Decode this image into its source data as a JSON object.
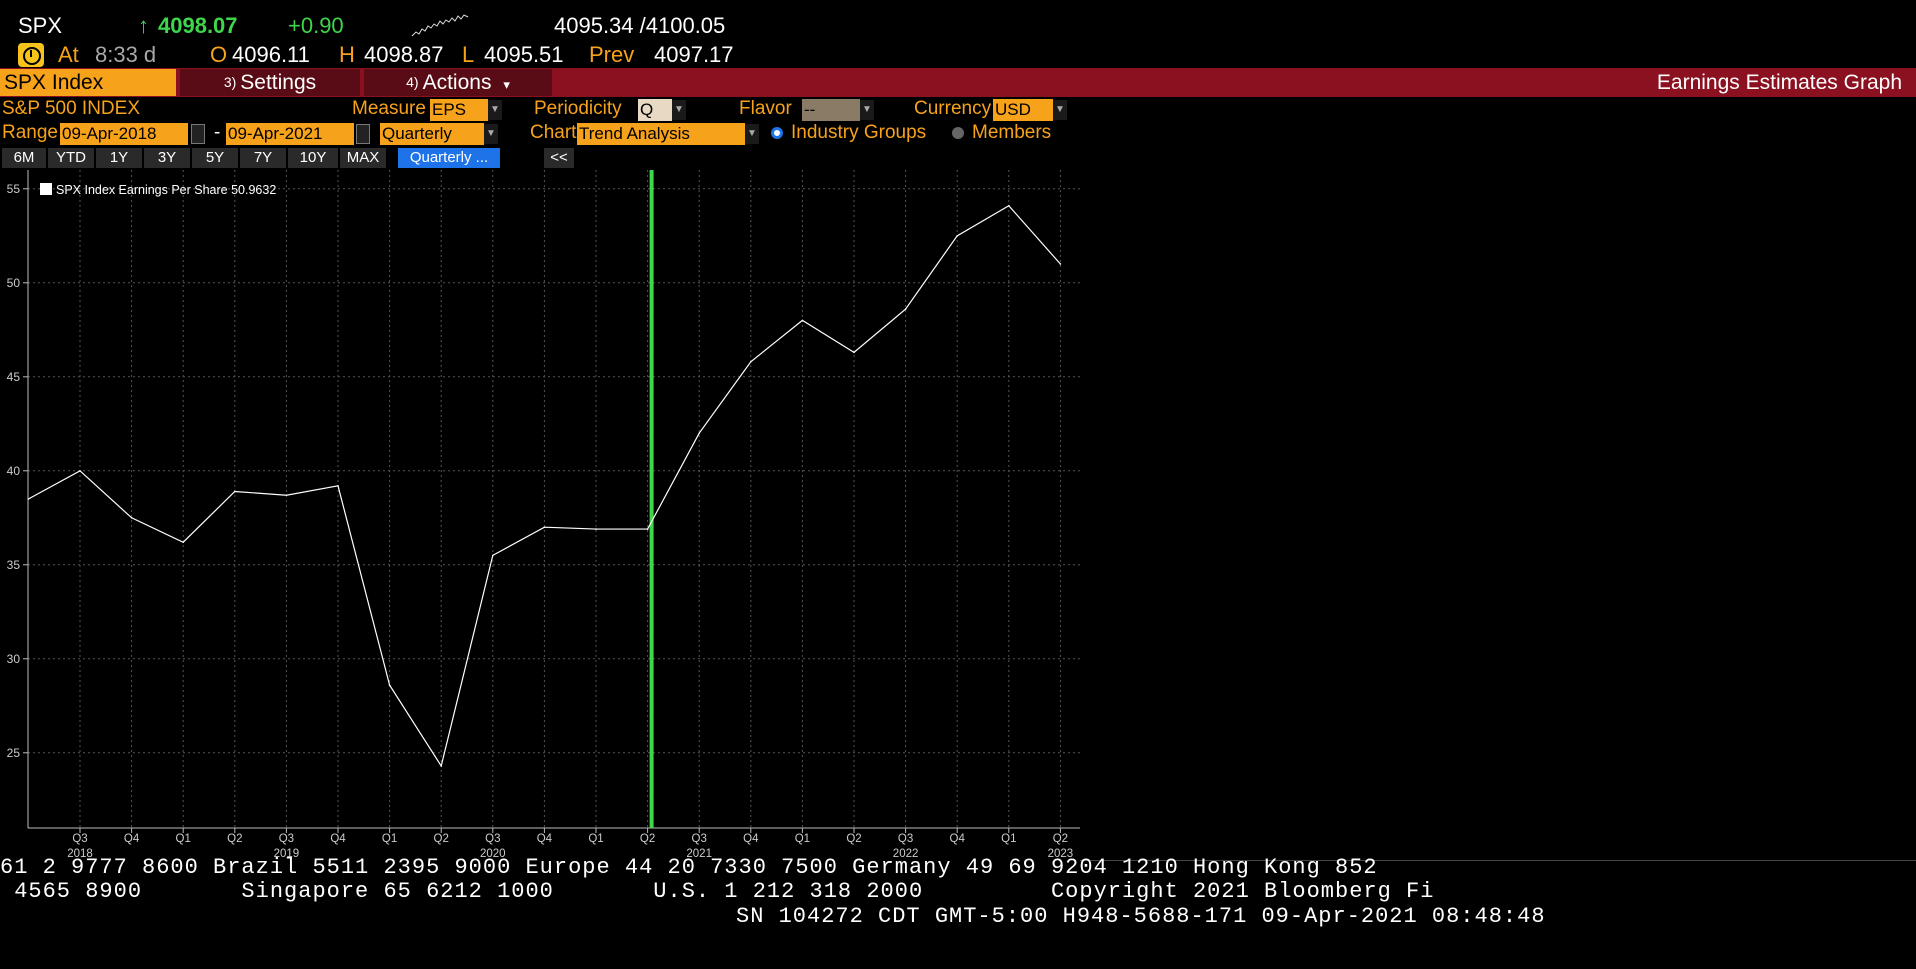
{
  "quote": {
    "ticker": "SPX",
    "arrow": "↑",
    "last": "4098.07",
    "change": "+0.90",
    "bid_ask": "4095.34 /4100.05",
    "at_label": "At",
    "time": "8:33 d",
    "open_label": "O",
    "open": "4096.11",
    "high_label": "H",
    "high": "4098.87",
    "low_label": "L",
    "low": "4095.51",
    "prev_label": "Prev",
    "prev": "4097.17"
  },
  "tabs": {
    "security": "SPX Index",
    "settings_num": "3)",
    "settings": "Settings",
    "actions_num": "4)",
    "actions": "Actions",
    "actions_caret": "▾",
    "screen_title": "Earnings Estimates Graph"
  },
  "controls": {
    "index_name": "S&P 500 INDEX",
    "measure_label": "Measure",
    "measure_value": "EPS",
    "periodicity_label": "Periodicity",
    "periodicity_value": "Q",
    "flavor_label": "Flavor",
    "flavor_value": "--",
    "currency_label": "Currency",
    "currency_value": "USD",
    "range_label": "Range",
    "range_start": "09-Apr-2018",
    "range_sep": "-",
    "range_end": "09-Apr-2021",
    "range_period": "Quarterly",
    "chart_label": "Chart",
    "chart_value": "Trend Analysis",
    "industry_groups": "Industry Groups",
    "members": "Members",
    "collapse": "<<"
  },
  "range_buttons": [
    "6M",
    "YTD",
    "1Y",
    "3Y",
    "5Y",
    "7Y",
    "10Y",
    "MAX",
    "Quarterly ..."
  ],
  "colors": {
    "accent": "#f7a21b",
    "title_bar": "#8b1020",
    "up": "#3ed64a",
    "today_marker": "#3ed64a",
    "series": "#ffffff",
    "active_button": "#1e73e8"
  },
  "chart_data": {
    "type": "line",
    "legend": "SPX Index Earnings Per Share 50.9632",
    "y_ticks": [
      "25",
      "30",
      "35",
      "40",
      "45",
      "50",
      "55"
    ],
    "ylim": [
      21,
      56
    ],
    "quarter_labels": [
      "Q3",
      "Q4",
      "Q1",
      "Q2",
      "Q3",
      "Q4",
      "Q1",
      "Q2",
      "Q3",
      "Q4",
      "Q1",
      "Q2",
      "Q3",
      "Q4",
      "Q1",
      "Q2",
      "Q3",
      "Q4",
      "Q1",
      "Q2"
    ],
    "year_labels": [
      {
        "year": "2018",
        "at": 0
      },
      {
        "year": "2019",
        "at": 4
      },
      {
        "year": "2020",
        "at": 8
      },
      {
        "year": "2021",
        "at": 12
      },
      {
        "year": "2022",
        "at": 16
      },
      {
        "year": "2023",
        "at": 19
      }
    ],
    "today_at": 11,
    "series": [
      {
        "name": "SPX Index Earnings Per Share",
        "points": [
          {
            "x": -1,
            "y": 38.5
          },
          {
            "x": 0,
            "y": 40.0
          },
          {
            "x": 1,
            "y": 37.5
          },
          {
            "x": 2,
            "y": 36.2
          },
          {
            "x": 3,
            "y": 38.9
          },
          {
            "x": 4,
            "y": 38.7
          },
          {
            "x": 5,
            "y": 39.2
          },
          {
            "x": 6,
            "y": 28.6
          },
          {
            "x": 7,
            "y": 24.3
          },
          {
            "x": 8,
            "y": 35.5
          },
          {
            "x": 9,
            "y": 37.0
          },
          {
            "x": 10,
            "y": 36.9
          },
          {
            "x": 11,
            "y": 36.9
          },
          {
            "x": 12,
            "y": 42.0
          },
          {
            "x": 13,
            "y": 45.8
          },
          {
            "x": 14,
            "y": 48.0
          },
          {
            "x": 15,
            "y": 46.3
          },
          {
            "x": 16,
            "y": 48.6
          },
          {
            "x": 17,
            "y": 52.5
          },
          {
            "x": 18,
            "y": 54.1
          },
          {
            "x": 19,
            "y": 51.0
          }
        ]
      }
    ],
    "grid": true
  },
  "ticker_lines": {
    "line1": "61 2 9777 8600 Brazil 5511 2395 9000 Europe 44 20 7330 7500 Germany 49 69 9204 1210 Hong Kong 852",
    "line2": " 4565 8900       Singapore 65 6212 1000       U.S. 1 212 318 2000         Copyright 2021 Bloomberg Fi",
    "line3": "SN 104272 CDT  GMT-5:00 H948-5688-171 09-Apr-2021 08:48:48"
  }
}
